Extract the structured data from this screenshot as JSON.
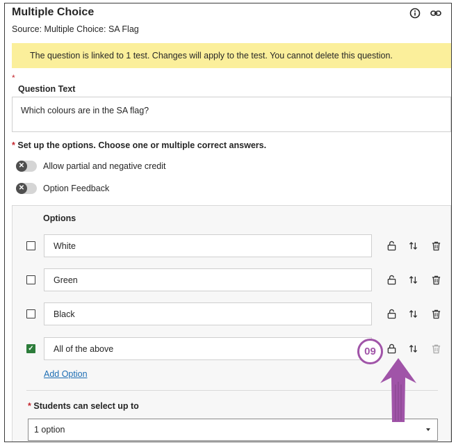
{
  "header": {
    "title": "Multiple Choice",
    "source": "Source: Multiple Choice: SA Flag"
  },
  "banner": {
    "text": "The question is linked to 1 test. Changes will apply to the test. You cannot delete this question."
  },
  "question": {
    "required_mark": "*",
    "label": "Question Text",
    "value": "Which colours are in the SA flag?"
  },
  "setup": {
    "required_mark": "*",
    "label": "Set up the options. Choose one or multiple correct answers."
  },
  "toggles": [
    {
      "label": "Allow partial and negative credit",
      "on": false
    },
    {
      "label": "Option Feedback",
      "on": false
    }
  ],
  "options": {
    "header": "Options",
    "items": [
      {
        "text": "White",
        "checked": false
      },
      {
        "text": "Green",
        "checked": false
      },
      {
        "text": "Black",
        "checked": false
      },
      {
        "text": "All of the above",
        "checked": true
      }
    ],
    "add_label": "Add Option"
  },
  "students": {
    "required_mark": "*",
    "label": "Students can select up to",
    "selected": "1 option"
  },
  "annotation": {
    "callout": "09",
    "color": "#a054a8"
  },
  "colors": {
    "banner": "#fbef9b",
    "required": "#c4262e",
    "link": "#1c6db3",
    "check": "#2c7c3a"
  },
  "icons": {
    "top": [
      "info-icon",
      "link-icon"
    ],
    "row_actions": [
      "lock-icon",
      "reorder-icon",
      "delete-icon"
    ]
  }
}
